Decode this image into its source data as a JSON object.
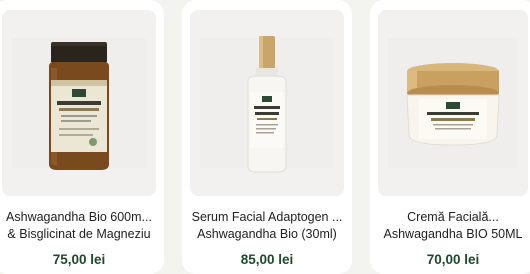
{
  "products": [
    {
      "name_line1": "Ashwagandha Bio 600m...",
      "name_line2": "& Bisglicinat de Magneziu",
      "price": "75,00 lei",
      "image_alt": "Ashwagandha supplement jar"
    },
    {
      "name_line1": "Serum Facial Adaptogen ...",
      "name_line2": "Ashwagandha Bio (30ml)",
      "price": "85,00 lei",
      "image_alt": "Ashwagandha facial serum dropper bottle"
    },
    {
      "name_line1": "Cremă Facială...",
      "name_line2": "Ashwagandha BIO 50ML",
      "price": "70,00 lei",
      "image_alt": "Ashwagandha face cream jar"
    }
  ],
  "colors": {
    "price": "#1d4a2c",
    "background": "#f3f4f0",
    "card": "#ffffff"
  }
}
